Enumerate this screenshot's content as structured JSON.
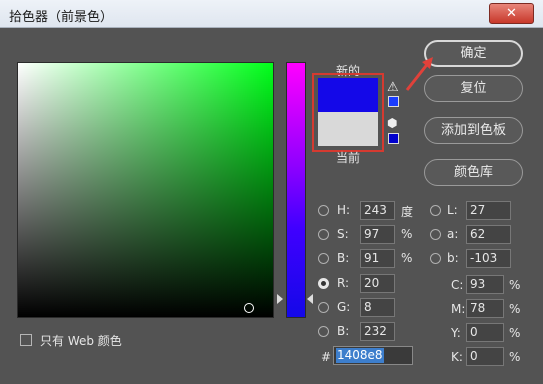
{
  "window": {
    "title": "拾色器（前景色）",
    "close_label": "✕"
  },
  "preview": {
    "new_label": "新的",
    "current_label": "当前",
    "new_color": "#1408e8",
    "current_color": "#d9d9d9"
  },
  "buttons": {
    "ok": "确定",
    "reset": "复位",
    "add_swatch": "添加到色板",
    "libraries": "颜色库"
  },
  "hsb": [
    {
      "label": "H:",
      "value": "243",
      "unit": "度"
    },
    {
      "label": "S:",
      "value": "97",
      "unit": "%"
    },
    {
      "label": "B:",
      "value": "91",
      "unit": "%"
    }
  ],
  "lab": [
    {
      "label": "L:",
      "value": "27"
    },
    {
      "label": "a:",
      "value": "62"
    },
    {
      "label": "b:",
      "value": "-103"
    }
  ],
  "rgb": [
    {
      "label": "R:",
      "value": "20",
      "selected": true
    },
    {
      "label": "G:",
      "value": "8"
    },
    {
      "label": "B:",
      "value": "232"
    }
  ],
  "cmyk": [
    {
      "label": "C:",
      "value": "93",
      "unit": "%"
    },
    {
      "label": "M:",
      "value": "78",
      "unit": "%"
    },
    {
      "label": "Y:",
      "value": "0",
      "unit": "%"
    },
    {
      "label": "K:",
      "value": "0",
      "unit": "%"
    }
  ],
  "hex": {
    "label": "#",
    "value": "1408e8"
  },
  "web_only": {
    "label": "只有 Web 颜色",
    "checked": false
  },
  "accent_colors": {
    "highlight_box": "#d53a30",
    "arrow": "#e0413a"
  },
  "icons": [
    "warning-icon",
    "cube-icon"
  ]
}
